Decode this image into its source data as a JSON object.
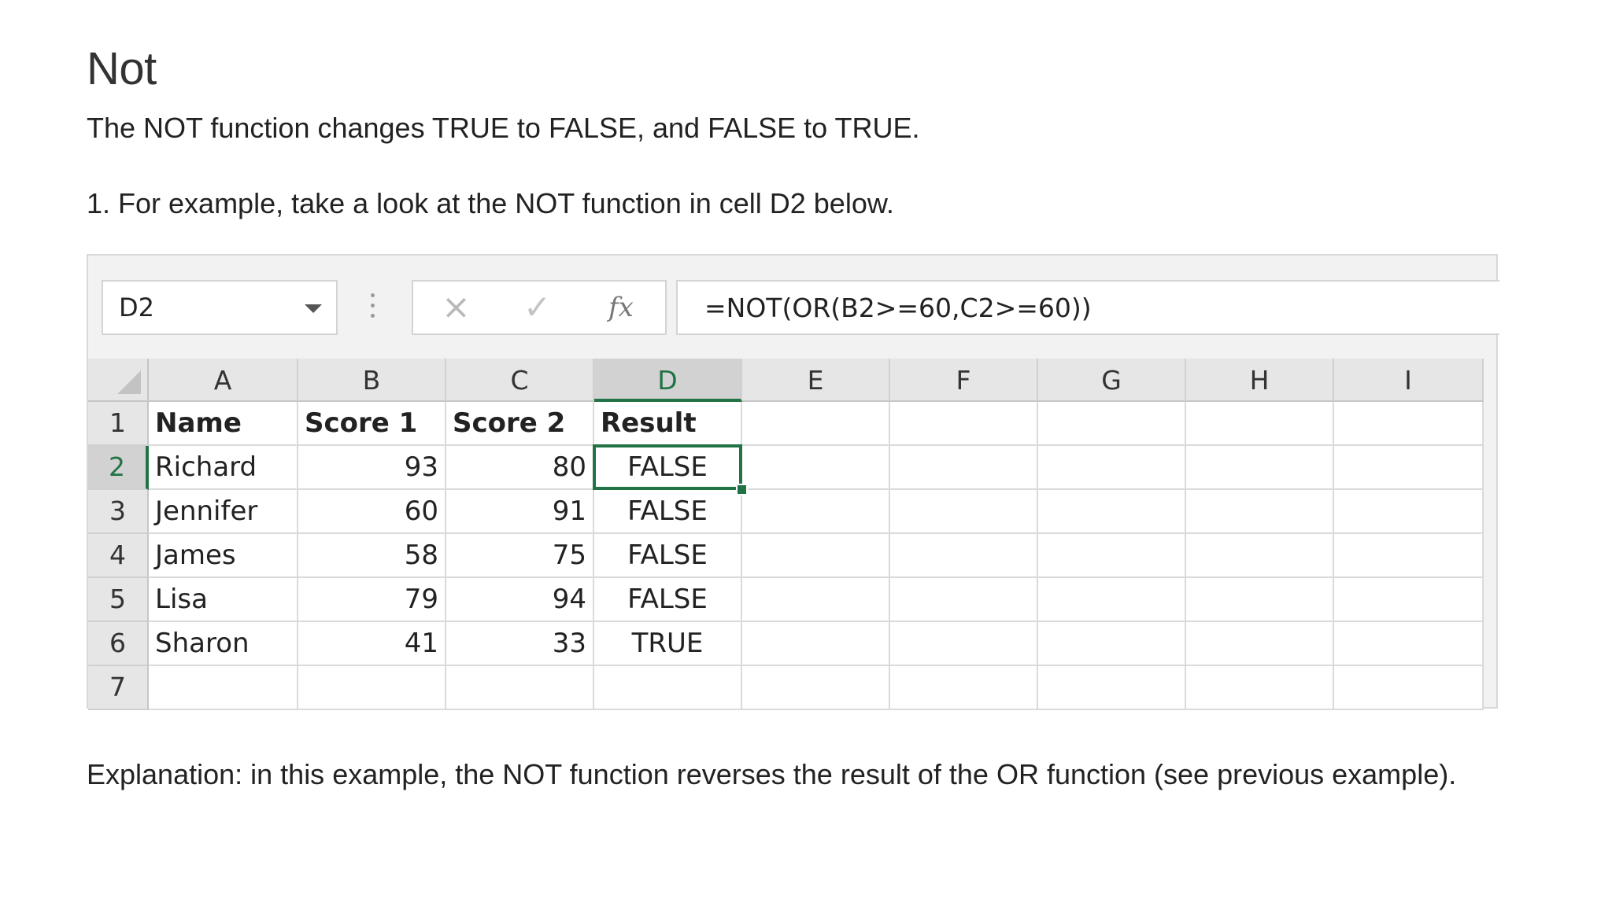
{
  "article": {
    "heading": "Not",
    "intro": "The NOT function changes TRUE to FALSE, and FALSE to TRUE.",
    "step": "1. For example, take a look at the NOT function in cell D2 below.",
    "explanation": "Explanation: in this example, the NOT function reverses the result of the OR function (see previous example)."
  },
  "excel": {
    "name_box": "D2",
    "fx_cancel_icon": "×",
    "fx_enter_icon": "✓",
    "fx_symbol": "fx",
    "formula": "=NOT(OR(B2>=60,C2>=60))",
    "columns": [
      "A",
      "B",
      "C",
      "D",
      "E",
      "F",
      "G",
      "H",
      "I"
    ],
    "active_column": "D",
    "rows": [
      "1",
      "2",
      "3",
      "4",
      "5",
      "6",
      "7"
    ],
    "active_row": "2",
    "headers": [
      "Name",
      "Score 1",
      "Score 2",
      "Result"
    ],
    "data": [
      [
        "Richard",
        "93",
        "80",
        "FALSE"
      ],
      [
        "Jennifer",
        "60",
        "91",
        "FALSE"
      ],
      [
        "James",
        "58",
        "75",
        "FALSE"
      ],
      [
        "Lisa",
        "79",
        "94",
        "FALSE"
      ],
      [
        "Sharon",
        "41",
        "33",
        "TRUE"
      ]
    ],
    "accent_color": "#217346"
  }
}
